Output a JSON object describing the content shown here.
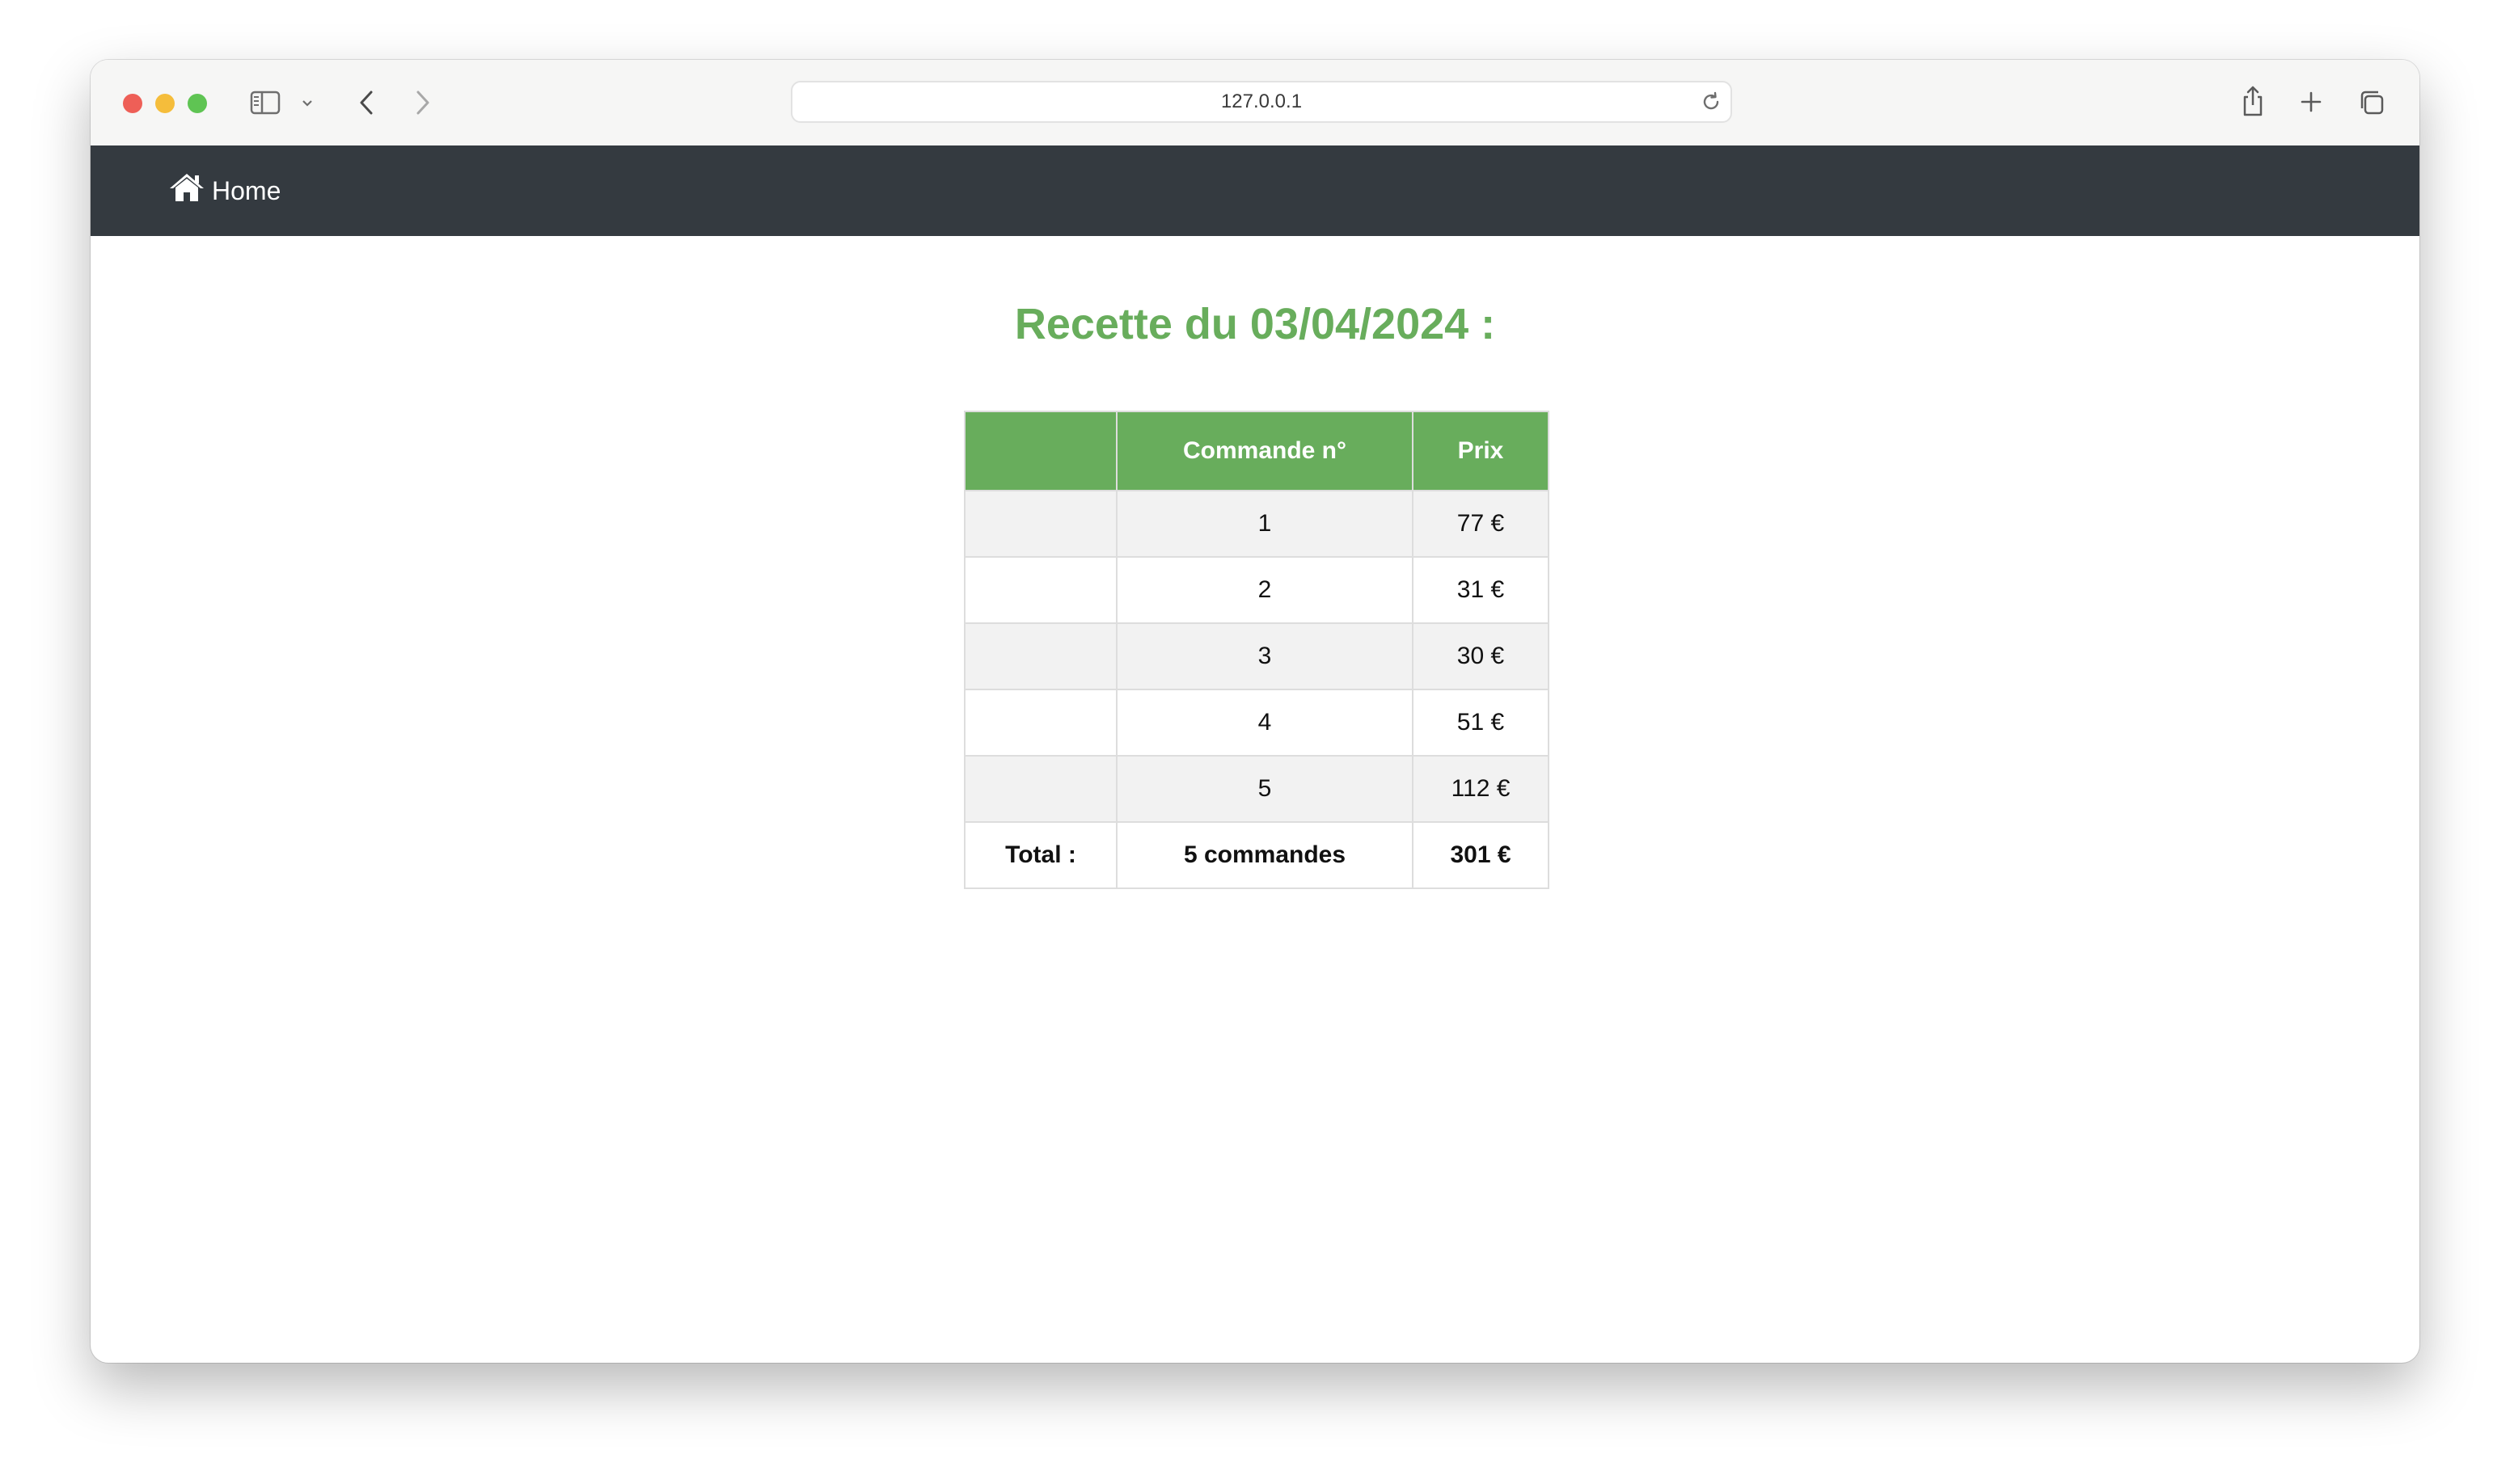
{
  "browser": {
    "url": "127.0.0.1"
  },
  "navbar": {
    "home_label": "Home"
  },
  "page": {
    "title": "Recette du 03/04/2024 :"
  },
  "table": {
    "headers": [
      "",
      "Commande n°",
      "Prix"
    ],
    "rows": [
      {
        "empty": "",
        "order": "1",
        "price": "77 €"
      },
      {
        "empty": "",
        "order": "2",
        "price": "31 €"
      },
      {
        "empty": "",
        "order": "3",
        "price": "30 €"
      },
      {
        "empty": "",
        "order": "4",
        "price": "51 €"
      },
      {
        "empty": "",
        "order": "5",
        "price": "112 €"
      }
    ],
    "total": {
      "label": "Total :",
      "orders": "5 commandes",
      "price": "301 €"
    }
  },
  "colors": {
    "accent_green": "#68ad5c",
    "navbar_bg": "#343a40",
    "stripe_bg": "#f2f2f2"
  }
}
